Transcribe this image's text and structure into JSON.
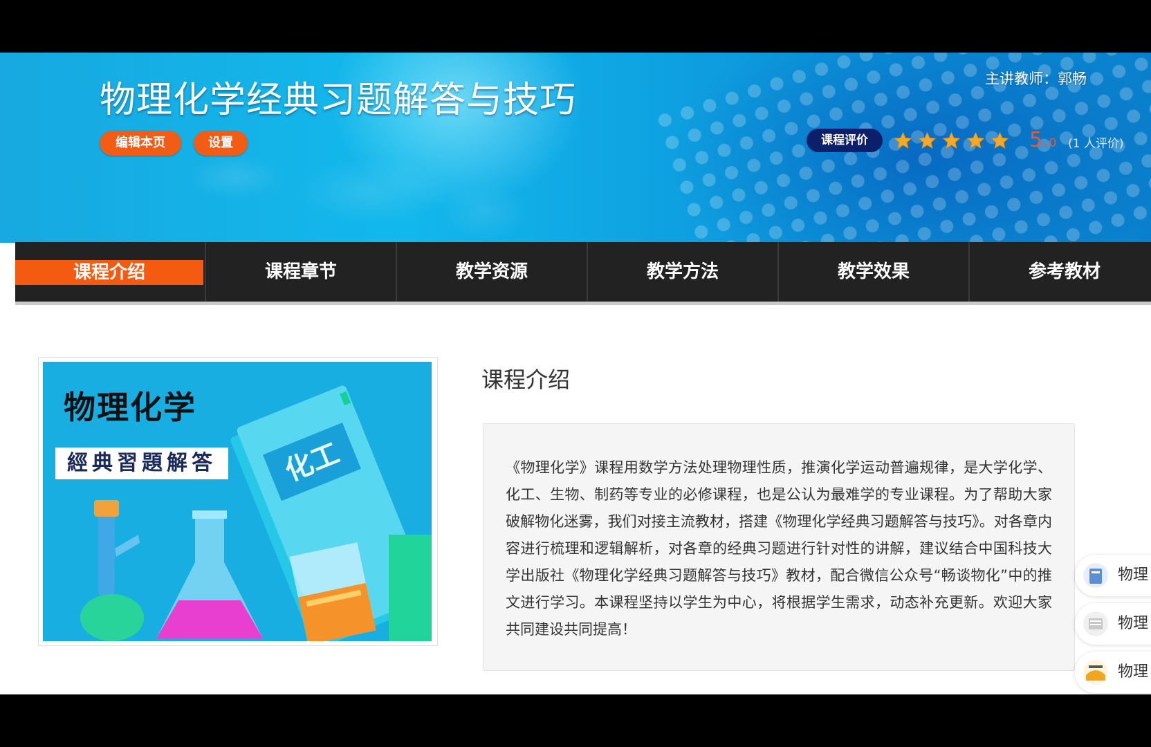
{
  "banner": {
    "course_title": "物理化学经典习题解答与技巧",
    "edit_button": "编辑本页",
    "settings_button": "设置",
    "teacher": "主讲教师：郭畅",
    "rating_badge": "课程评价",
    "rating_score_main": "5.",
    "rating_score_decimal": "0",
    "rating_count": "(1 人评价)",
    "stars": 5
  },
  "nav": {
    "items": [
      {
        "label": "课程介绍",
        "active": true
      },
      {
        "label": "课程章节",
        "active": false
      },
      {
        "label": "教学资源",
        "active": false
      },
      {
        "label": "教学方法",
        "active": false
      },
      {
        "label": "教学效果",
        "active": false
      },
      {
        "label": "参考教材",
        "active": false
      }
    ]
  },
  "cover": {
    "title": "物理化学",
    "subtitle": "經典習題解答",
    "book_label": "化工"
  },
  "intro": {
    "heading": "课程介绍",
    "text": "《物理化学》课程用数学方法处理物理性质，推演化学运动普遍规律，是大学化学、化工、生物、制药等专业的必修课程，也是公认为最难学的专业课程。为了帮助大家破解物化迷雾，我们对接主流教材，搭建《物理化学经典习题解答与技巧》。对各章内容进行梳理和逻辑解析，对各章的经典习题进行针对性的讲解，建议结合中国科技大学出版社《物理化学经典习题解答与技巧》教材，配合微信公众号“畅谈物化”中的推文进行学习。本课程坚持以学生为中心，将根据学生需求，动态补充更新。欢迎大家共同建设共同提高！"
  },
  "related": {
    "items": [
      {
        "label": "物理",
        "thumb_color": "#5a8fd6"
      },
      {
        "label": "物理",
        "thumb_color": "#c8c8c8"
      },
      {
        "label": "物理",
        "thumb_color": "#f2a51e"
      }
    ]
  },
  "colors": {
    "accent_orange": "#f25c14",
    "nav_bg": "#222222",
    "badge_navy": "#0c1f6b",
    "star_gold": "#f7a825"
  }
}
